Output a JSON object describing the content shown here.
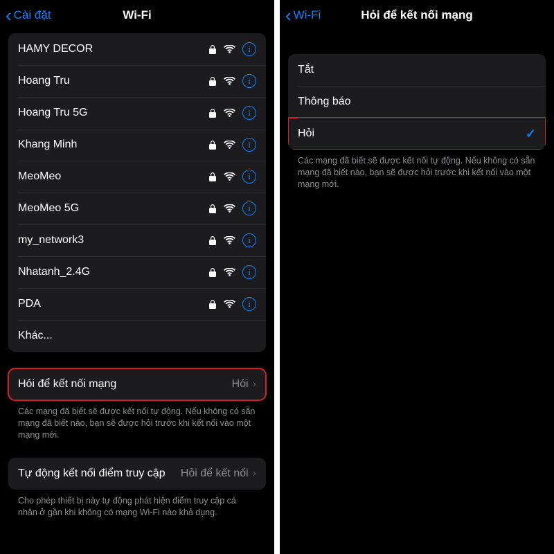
{
  "colors": {
    "accent": "#0a84ff",
    "highlight": "#d92020"
  },
  "screen1": {
    "back_label": "Cài đặt",
    "title": "Wi-Fi",
    "networks": [
      {
        "name": "HAMY DECOR",
        "locked": true
      },
      {
        "name": "Hoang Tru",
        "locked": true
      },
      {
        "name": "Hoang Tru 5G",
        "locked": true
      },
      {
        "name": "Khang Minh",
        "locked": true
      },
      {
        "name": "MeoMeo",
        "locked": true
      },
      {
        "name": "MeoMeo 5G",
        "locked": true
      },
      {
        "name": "my_network3",
        "locked": true
      },
      {
        "name": "Nhatanh_2.4G",
        "locked": true
      },
      {
        "name": "PDA",
        "locked": true
      }
    ],
    "other_label": "Khác...",
    "ask_join": {
      "label": "Hỏi để kết nối mạng",
      "value": "Hỏi",
      "footer": "Các mạng đã biết sẽ được kết nối tự động. Nếu không có sẵn mạng đã biết nào, bạn sẽ được hỏi trước khi kết nối vào một mạng mới."
    },
    "auto_hotspot": {
      "label": "Tự động kết nối điểm truy cập",
      "value": "Hỏi để kết nối",
      "footer": "Cho phép thiết bị này tự động phát hiện điểm truy cập cá nhân ở gần khi không có mạng Wi-Fi nào khả dụng."
    }
  },
  "screen2": {
    "back_label": "Wi-Fi",
    "title": "Hỏi để kết nối mạng",
    "options": [
      {
        "label": "Tắt",
        "selected": false
      },
      {
        "label": "Thông báo",
        "selected": false
      },
      {
        "label": "Hỏi",
        "selected": true,
        "highlight": true
      }
    ],
    "footer": "Các mạng đã biết sẽ được kết nối tự động. Nếu không có sẵn mạng đã biết nào, bạn sẽ được hỏi trước khi kết nối vào một mạng mới."
  }
}
